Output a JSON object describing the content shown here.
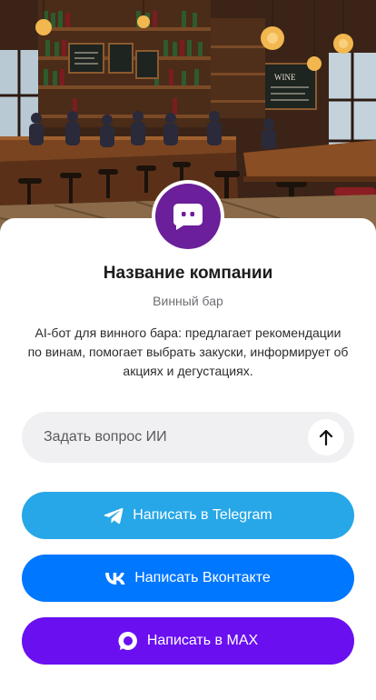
{
  "company": {
    "name": "Название компании",
    "type": "Винный бар",
    "description": "AI-бот для винного бара: предлагает рекомендации по винам, помогает выбрать закуски, информирует об акциях и дегустациях."
  },
  "hero": {
    "image": "wine-bar-interior",
    "sign_text": "WINE"
  },
  "ask": {
    "placeholder": "Задать вопрос ИИ",
    "value": ""
  },
  "buttons": {
    "telegram": {
      "label": "Написать в Telegram",
      "icon": "telegram-icon",
      "color": "#27a7e7"
    },
    "vk": {
      "label": "Написать Вконтакте",
      "icon": "vk-icon",
      "color": "#0077ff"
    },
    "max": {
      "label": "Написать в MAX",
      "icon": "max-icon",
      "color": "#6a0ff0"
    }
  },
  "colors": {
    "avatar_bg": "#6b1f9a"
  }
}
